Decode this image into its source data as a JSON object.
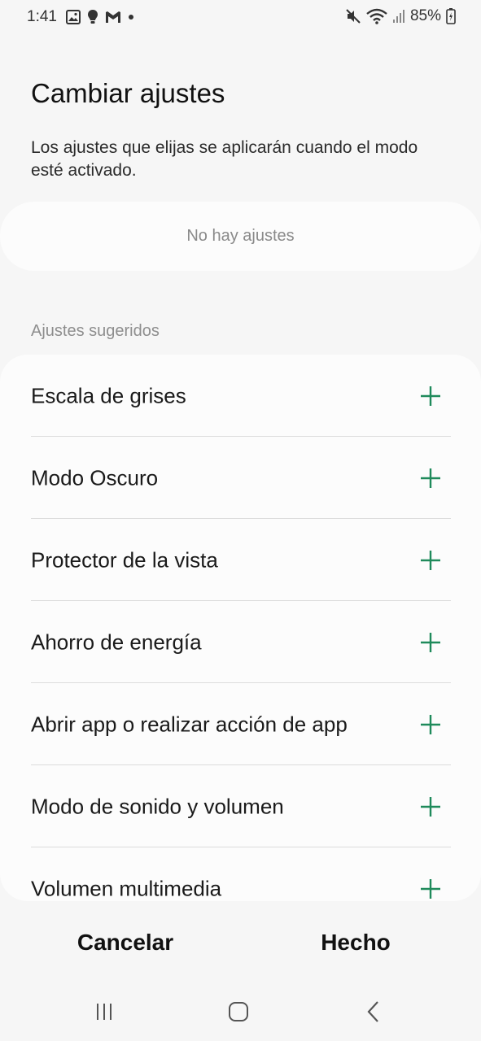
{
  "status_bar": {
    "time": "1:41",
    "battery": "85%",
    "left_icons": [
      "gallery-icon",
      "bulb-icon",
      "gmail-icon",
      "dot-icon"
    ],
    "right_icons": [
      "mute-icon",
      "wifi-icon",
      "signal-icon",
      "battery-icon"
    ]
  },
  "header": {
    "title": "Cambiar ajustes",
    "description": "Los ajustes que elijas se aplicarán cuando el modo esté activado."
  },
  "current_settings": {
    "empty_text": "No hay ajustes"
  },
  "suggested": {
    "header": "Ajustes sugeridos",
    "items": [
      {
        "label": "Escala de grises",
        "icon": "plus-icon"
      },
      {
        "label": "Modo Oscuro",
        "icon": "plus-icon"
      },
      {
        "label": "Protector de la vista",
        "icon": "plus-icon"
      },
      {
        "label": "Ahorro de energía",
        "icon": "plus-icon"
      },
      {
        "label": "Abrir app o realizar acción de app",
        "icon": "plus-icon"
      },
      {
        "label": "Modo de sonido y volumen",
        "icon": "plus-icon"
      },
      {
        "label": "Volumen multimedia",
        "icon": "plus-icon"
      }
    ]
  },
  "actions": {
    "cancel_label": "Cancelar",
    "done_label": "Hecho"
  },
  "nav": {
    "icons": [
      "recent-apps-icon",
      "home-icon",
      "back-icon"
    ]
  },
  "colors": {
    "accent": "#1f8a5b",
    "background": "#f6f6f6",
    "card": "#fcfcfc"
  }
}
